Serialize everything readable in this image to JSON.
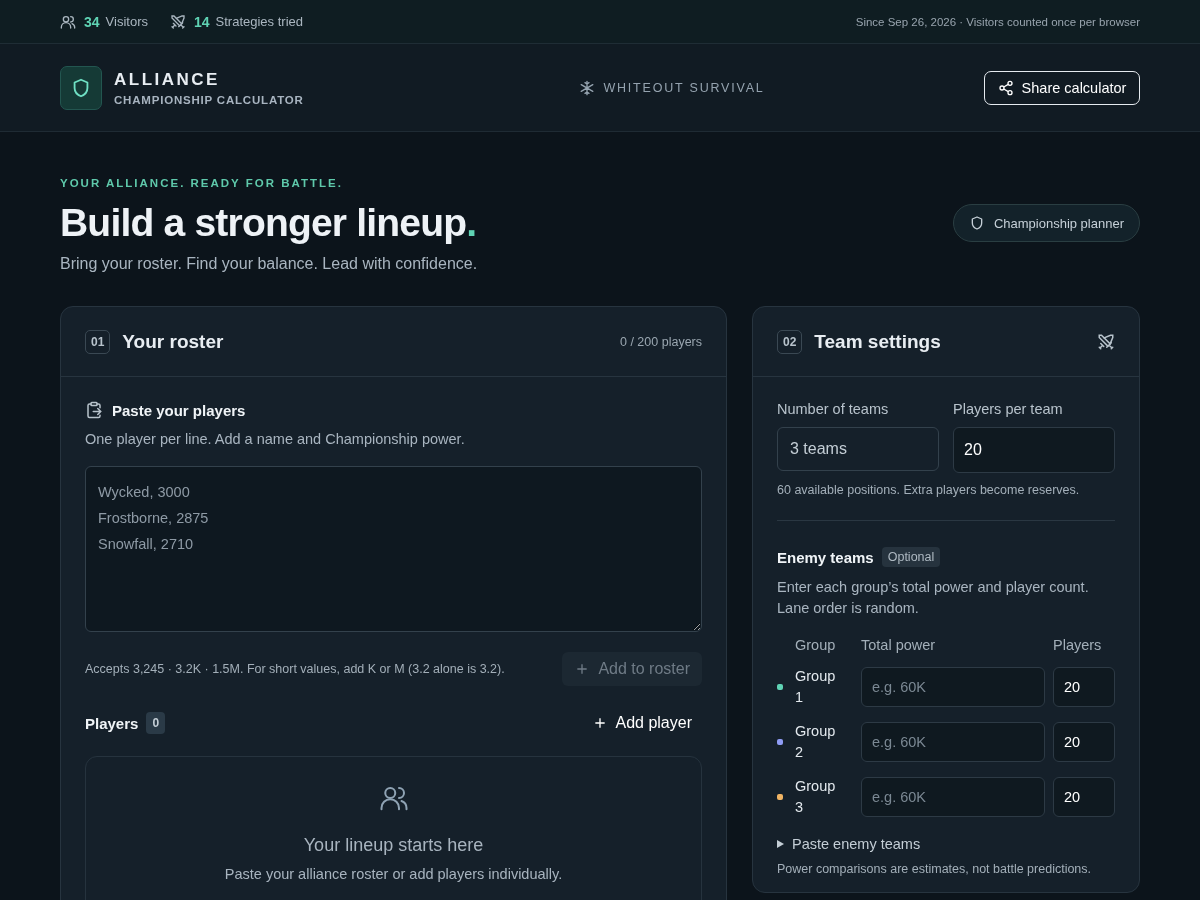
{
  "topbar": {
    "stats": [
      {
        "kind": "visitors",
        "value": "34",
        "label": "Visitors"
      },
      {
        "kind": "strategies",
        "value": "14",
        "label": "Strategies tried"
      }
    ],
    "note": "Since Sep 26, 2026 · Visitors counted once per browser"
  },
  "header": {
    "title": "ALLIANCE",
    "subtitle": "CHAMPIONSHIP CALCULATOR",
    "game": "WHITEOUT SURVIVAL",
    "share_button": "Share calculator"
  },
  "hero": {
    "eyebrow": "YOUR ALLIANCE. READY FOR BATTLE.",
    "title": "Build a stronger lineup",
    "title_end": ".",
    "subtitle": "Bring your roster. Find your balance. Lead with confidence.",
    "badge": "Championship planner"
  },
  "roster": {
    "number": "01",
    "title": "Your roster",
    "count": "0 / 200 players",
    "paste_title": "Paste your players",
    "paste_hint": "One player per line. Add a name and Championship power.",
    "paste_placeholder": "Wycked, 3000\nFrostborne, 2875\nSnowfall, 2710",
    "accepts": "Accepts 3,245 · 3.2K · 1.5M. For short values, add K or M (3.2 alone is 3.2).",
    "add_button": {
      "label": "Add to roster",
      "disabled": true
    },
    "players_label": "Players",
    "players_count": "0",
    "add_player": "Add player",
    "empty_title": "Your lineup starts here",
    "empty_text": "Paste your alliance roster or add players individually."
  },
  "settings": {
    "number": "02",
    "title": "Team settings",
    "teams_label": "Number of teams",
    "teams_value": "3 teams",
    "per_team_label": "Players per team",
    "per_team_value": "20",
    "positions_note": "60 available positions. Extra players become reserves.",
    "enemy_title": "Enemy teams",
    "enemy_badge": "Optional",
    "enemy_hint": "Enter each group’s total power and player count. Lane order is random.",
    "columns": [
      "Group",
      "Total power",
      "Players"
    ],
    "groups": [
      {
        "name": "Group 1",
        "color": "#5fd3b4",
        "power_placeholder": "e.g. 60K",
        "players": "20"
      },
      {
        "name": "Group 2",
        "color": "#8f9cf5",
        "power_placeholder": "e.g. 60K",
        "players": "20"
      },
      {
        "name": "Group 3",
        "color": "#f0b464",
        "power_placeholder": "e.g. 60K",
        "players": "20"
      }
    ],
    "paste_enemy": {
      "label": "Paste enemy teams",
      "expanded": false
    },
    "disclaimer": "Power comparisons are estimates, not battle predictions."
  }
}
